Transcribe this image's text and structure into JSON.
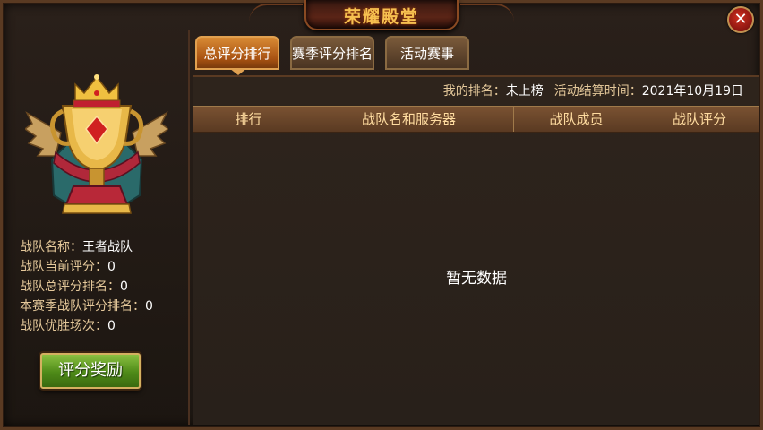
{
  "title": "荣耀殿堂",
  "close_glyph": "✕",
  "team": {
    "name_label": "战队名称：",
    "name_value": "王者战队",
    "score_label": "战队当前评分：",
    "score_value": "0",
    "total_rank_label": "战队总评分排名：",
    "total_rank_value": "0",
    "season_rank_label": "本赛季战队评分排名：",
    "season_rank_value": "0",
    "wins_label": "战队优胜场次：",
    "wins_value": "0"
  },
  "reward_button": "评分奖励",
  "tabs": [
    {
      "label": "总评分排行",
      "active": true
    },
    {
      "label": "赛季评分排名",
      "active": false
    },
    {
      "label": "活动赛事",
      "active": false
    }
  ],
  "my_rank_label": "我的排名：",
  "my_rank_value": "未上榜",
  "end_time_label": "活动结算时间：",
  "end_time_value": "2021年10月19日",
  "columns": [
    "排行",
    "战队名和服务器",
    "战队成员",
    "战队评分"
  ],
  "empty_text": "暂无数据",
  "icons": {
    "emblem": "trophy-crown-wings-icon",
    "close": "close-icon"
  },
  "colors": {
    "title": "#f6c050",
    "label": "#e4c89a",
    "active_tab": "#c06a20",
    "reward_button": "#5e9a22"
  }
}
